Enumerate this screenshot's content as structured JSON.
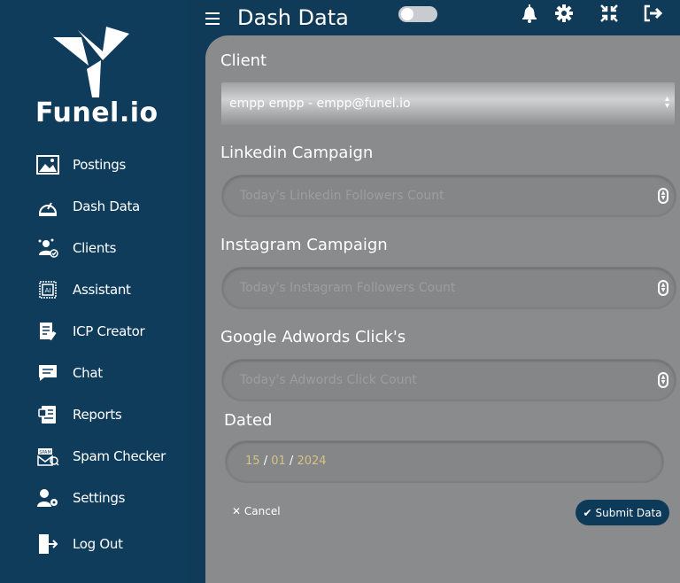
{
  "brand": {
    "name": "Funel.io"
  },
  "sidebar": {
    "items": [
      {
        "label": "Postings",
        "icon": "image-icon"
      },
      {
        "label": "Dash Data",
        "icon": "dashboard-icon"
      },
      {
        "label": "Clients",
        "icon": "clients-icon"
      },
      {
        "label": "Assistant",
        "icon": "ai-chip-icon"
      },
      {
        "label": "ICP Creator",
        "icon": "document-edit-icon"
      },
      {
        "label": "Chat",
        "icon": "chat-icon"
      },
      {
        "label": "Reports",
        "icon": "reports-icon"
      },
      {
        "label": "Spam Checker",
        "icon": "spam-mail-icon"
      },
      {
        "label": "Settings",
        "icon": "user-settings-icon"
      },
      {
        "label": "Log Out",
        "icon": "logout-icon"
      }
    ]
  },
  "header": {
    "title": "Dash Data",
    "icons": [
      "bell-icon",
      "gear-icon",
      "compress-icon",
      "sign-out-icon"
    ]
  },
  "form": {
    "client": {
      "label": "Client",
      "value": "empp empp - empp@funel.io"
    },
    "linkedin": {
      "label": "Linkedin Campaign",
      "placeholder": "Today's Linkedin Followers Count"
    },
    "instagram": {
      "label": "Instagram Campaign",
      "placeholder": "Today's Instagram Followers Count"
    },
    "adwords": {
      "label": "Google Adwords Click's",
      "placeholder": "Today's Adwords Click Count"
    },
    "dated": {
      "label": "Dated",
      "day": "15",
      "month": "01",
      "year": "2024",
      "separator": "/"
    },
    "cancel_label": "Cancel",
    "submit_label": "Submit Data"
  },
  "colors": {
    "sidebar": "#103c5c",
    "panel": "#8a8b8d",
    "date_text": "#d6c383",
    "submit_bg": "#0e3a5a"
  }
}
